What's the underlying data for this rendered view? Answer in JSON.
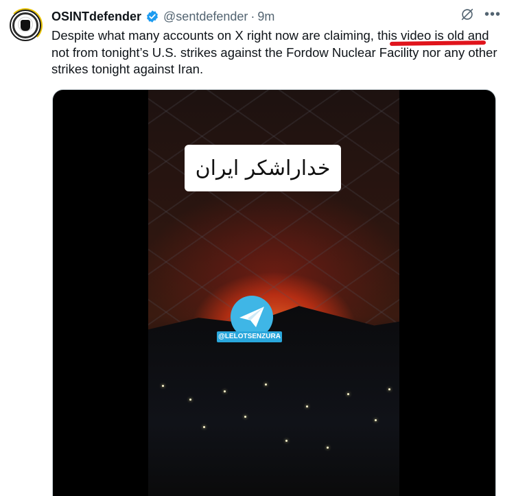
{
  "tweet": {
    "author_name": "OSINTdefender",
    "handle": "@sentdefender",
    "separator": "·",
    "time": "9m",
    "text_before": "Despite what many accounts on X right now are claiming, ",
    "text_highlight": "this video is old",
    "text_after": " and not from tonight’s U.S. strikes against the Fordow Nuclear Facility nor any other strikes tonight against Iran."
  },
  "media": {
    "video_caption": "خداراشکر ایران",
    "watermark_tag": "@LELOTSENZURA"
  },
  "icons": {
    "verified": "verified-badge-icon",
    "grok": "grok-icon",
    "more": "more-options-icon"
  },
  "colors": {
    "verified_blue": "#1d9bf0",
    "annotation_red": "#e0141c",
    "muted_text": "#536471"
  }
}
